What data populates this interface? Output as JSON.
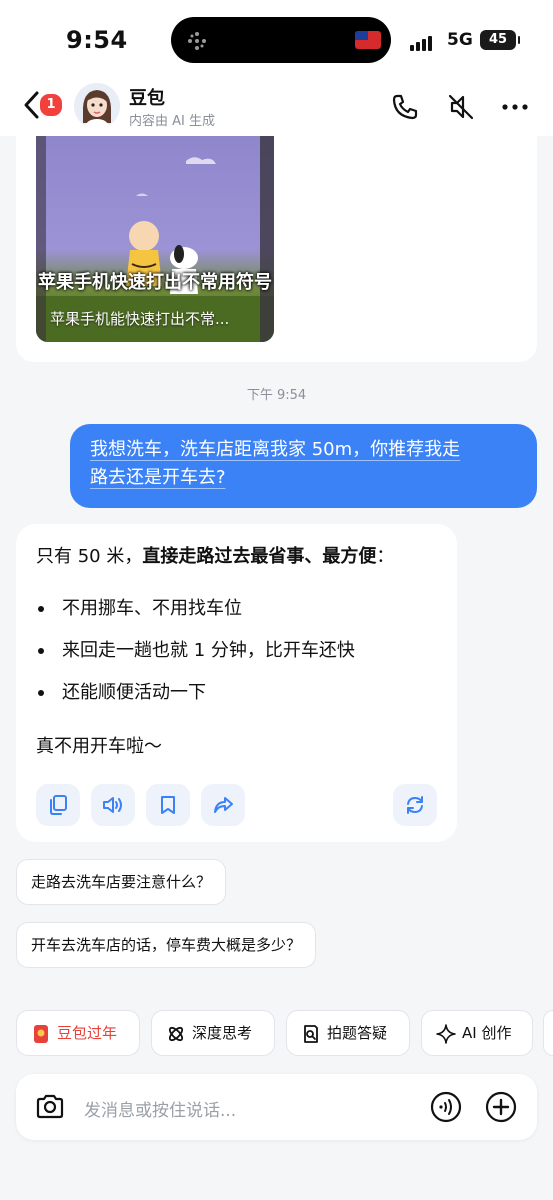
{
  "status_bar": {
    "time": "9:54",
    "network": "5G",
    "battery": "45"
  },
  "header": {
    "back_badge": "1",
    "name": "豆包",
    "subtitle": "内容由 AI 生成"
  },
  "video_card": {
    "caption": "苹果手机快速打出不常用符号",
    "title": "苹果手机能快速打出不常..."
  },
  "timestamp": "下午 9:54",
  "user_message": {
    "line1": "我想洗车，洗车店距离我家 50m，你推荐我走",
    "line2": "路去还是开车去?"
  },
  "ai_message": {
    "intro_plain": "只有 50 米，",
    "intro_bold": "直接走路过去最省事、最方便",
    "intro_end": "：",
    "bullets": [
      "不用挪车、不用找车位",
      "来回走一趟也就 1 分钟，比开车还快",
      "还能顺便活动一下"
    ],
    "closing": "真不用开车啦～"
  },
  "suggestions": [
    "走路去洗车店要注意什么？",
    "开车去洗车店的话，停车费大概是多少？"
  ],
  "chips": [
    {
      "label": "豆包过年",
      "icon": "red-envelope-icon",
      "color": "#e8413a"
    },
    {
      "label": "深度思考",
      "icon": "atom-icon",
      "color": "#111111"
    },
    {
      "label": "拍题答疑",
      "icon": "search-doc-icon",
      "color": "#111111"
    },
    {
      "label": "AI 创作",
      "icon": "sparkle-icon",
      "color": "#111111"
    }
  ],
  "input": {
    "placeholder": "发消息或按住说话..."
  },
  "colors": {
    "accent": "#3b82f6",
    "badge": "#f2413c",
    "festival": "#e8413a"
  }
}
